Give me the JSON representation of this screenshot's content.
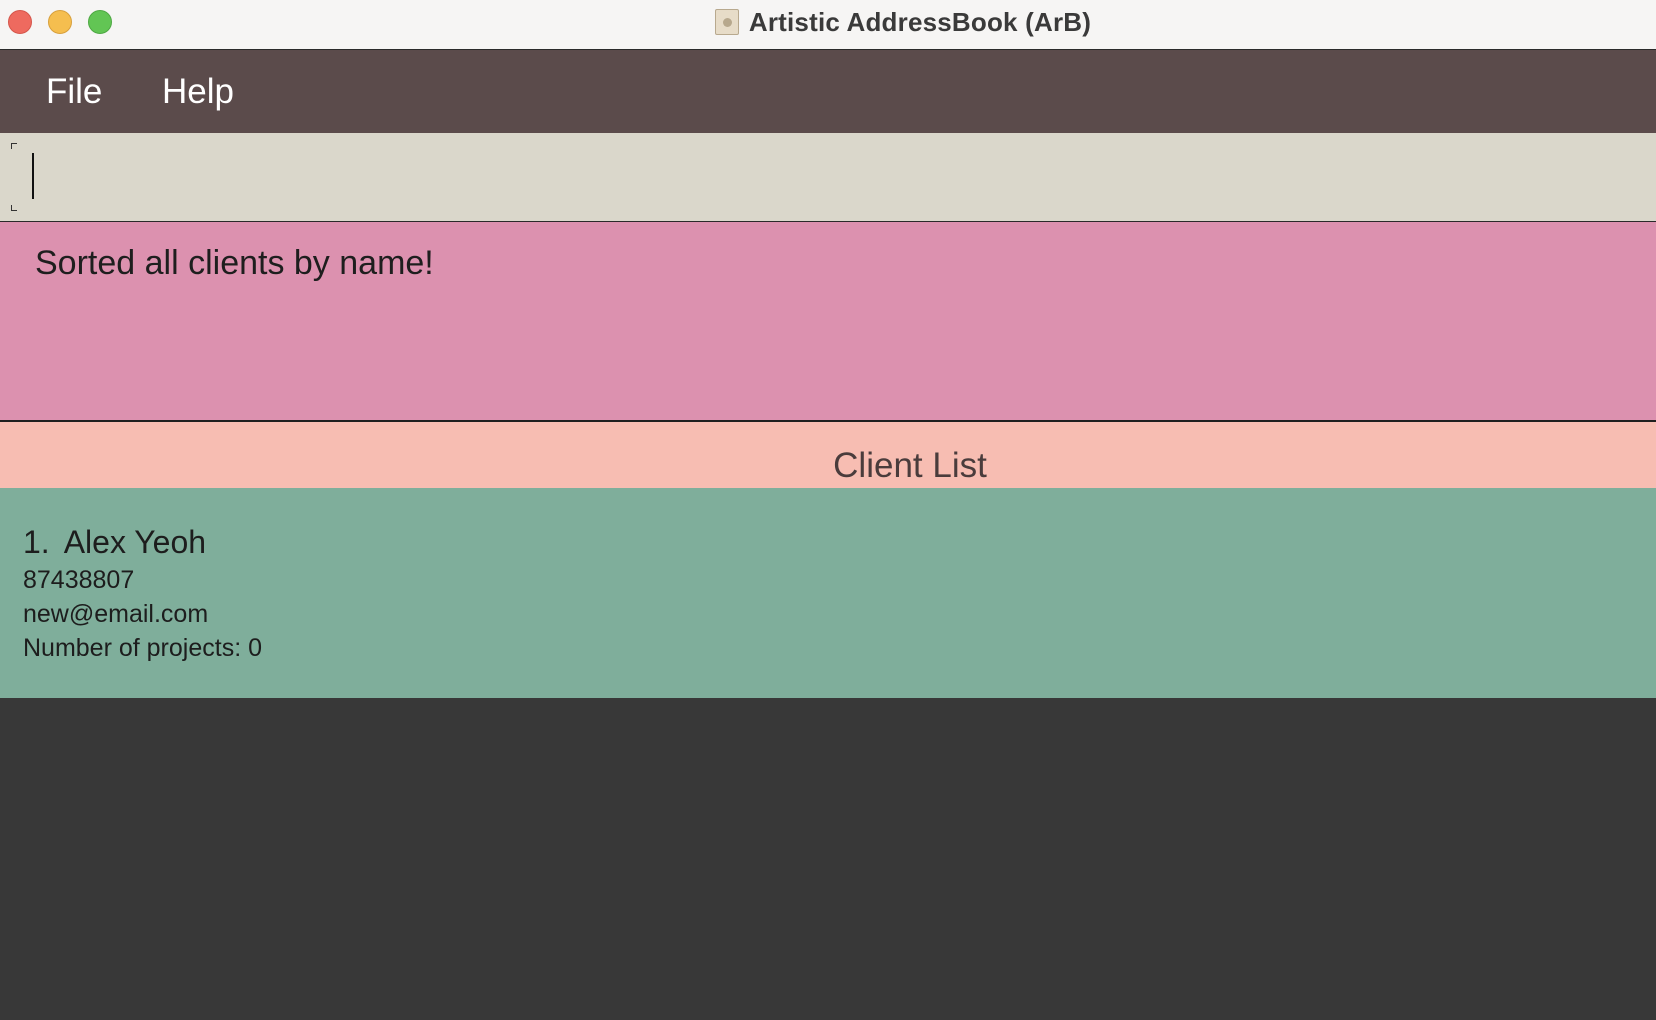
{
  "window": {
    "title": "Artistic AddressBook (ArB)",
    "icon": "addressbook-icon"
  },
  "menu": {
    "items": [
      {
        "label": "File"
      },
      {
        "label": "Help"
      }
    ]
  },
  "command_box": {
    "value": "",
    "placeholder": ""
  },
  "result_display": {
    "message": "Sorted all clients by name!"
  },
  "client_list": {
    "title": "Client List",
    "clients": [
      {
        "index": "1.",
        "name": "Alex Yeoh",
        "phone": "87438807",
        "email": "new@email.com",
        "projects": "Number of projects: 0"
      }
    ]
  },
  "colors": {
    "titlebar": "#f6f5f4",
    "menubar": "#5b4b4b",
    "command_box": "#dad7cb",
    "result_display": "#dc91af",
    "list_header": "#f7bdb2",
    "client_card": "#7fae9b",
    "background": "#383838"
  }
}
